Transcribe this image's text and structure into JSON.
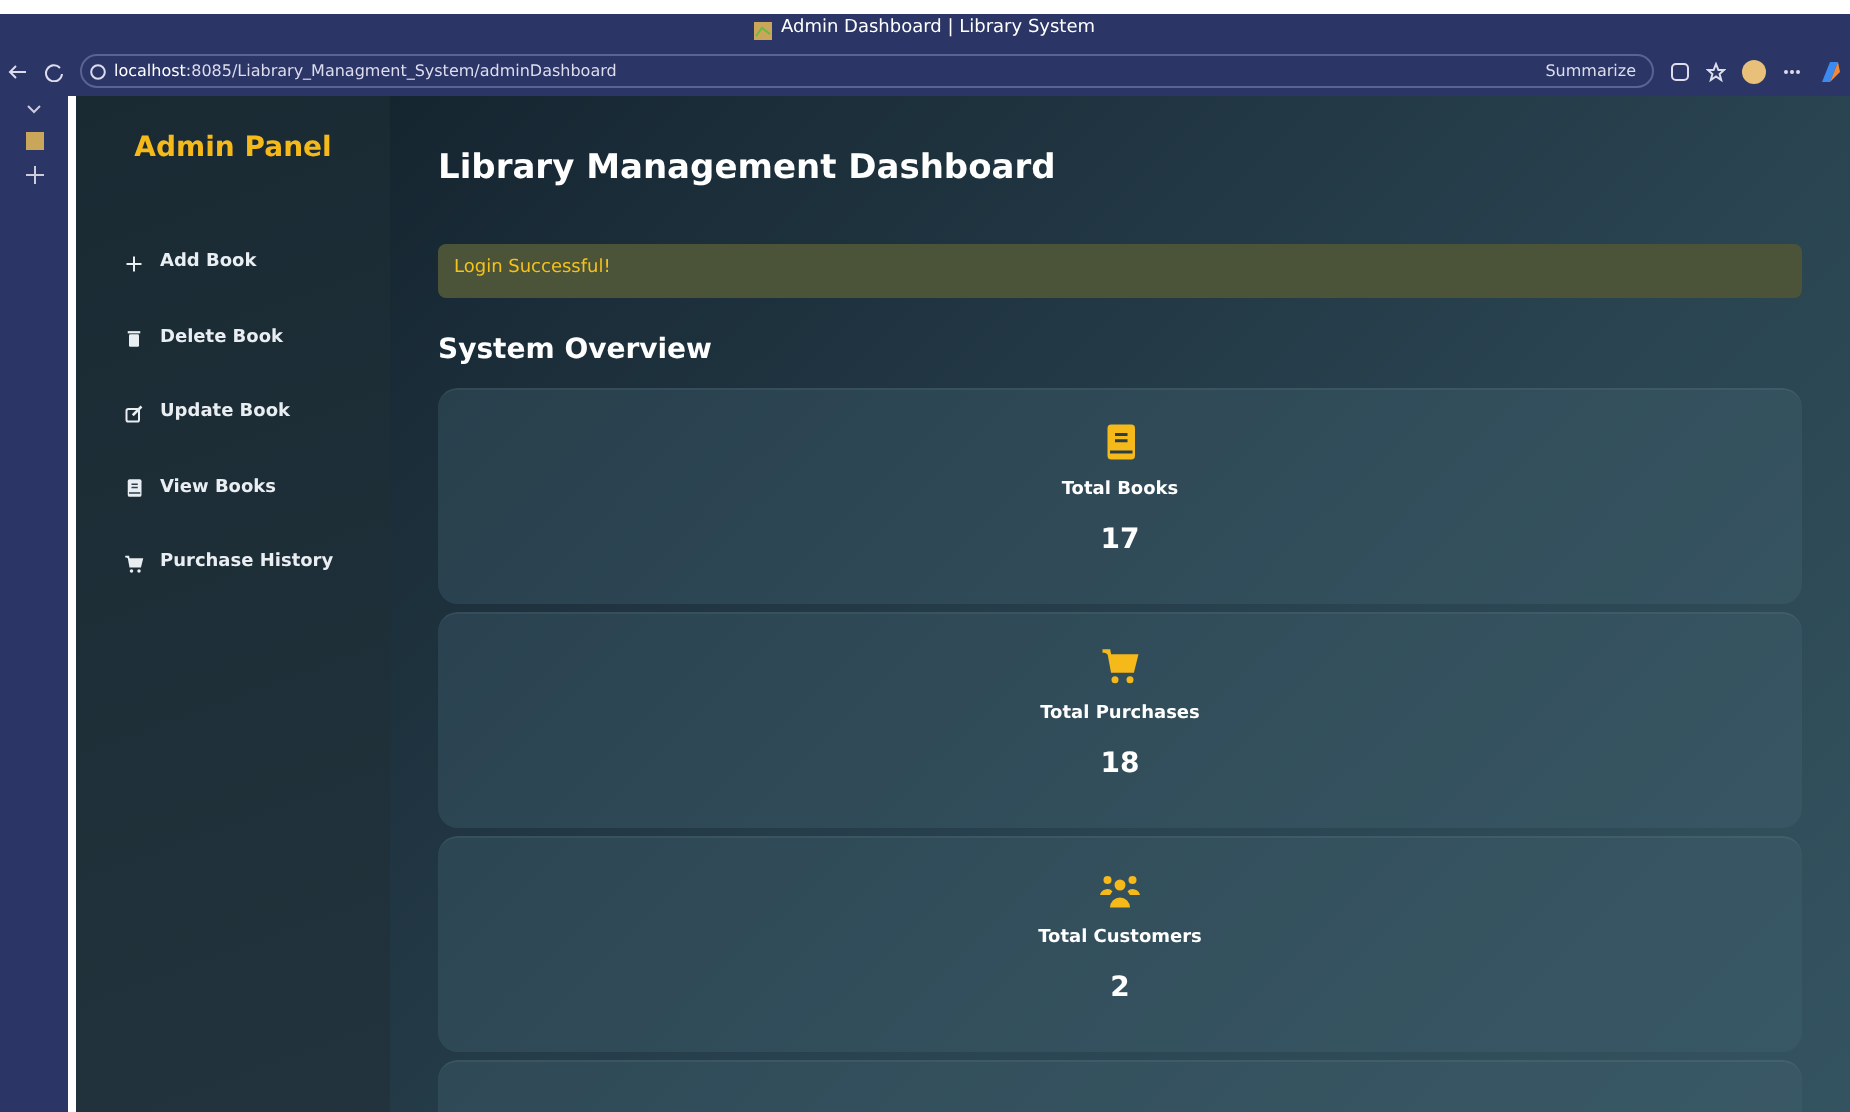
{
  "browser": {
    "title": "Admin Dashboard | Library System",
    "url_host": "localhost",
    "url_rest": ":8085/Liabrary_Managment_System/adminDashboard",
    "summarize": "Summarize"
  },
  "sidebar": {
    "title": "Admin Panel",
    "items": [
      {
        "label": "Add Book"
      },
      {
        "label": "Delete Book"
      },
      {
        "label": "Update Book"
      },
      {
        "label": "View Books"
      },
      {
        "label": "Purchase History"
      }
    ]
  },
  "main": {
    "title": "Library Management Dashboard",
    "alert": "Login Successful!",
    "section_title": "System Overview",
    "stats": [
      {
        "kind": "stat",
        "label": "Total Books",
        "value": "17"
      },
      {
        "kind": "stat",
        "label": "Total Purchases",
        "value": "18"
      },
      {
        "kind": "stat",
        "label": "Total Customers",
        "value": "2"
      },
      {
        "kind": "cut"
      }
    ]
  }
}
